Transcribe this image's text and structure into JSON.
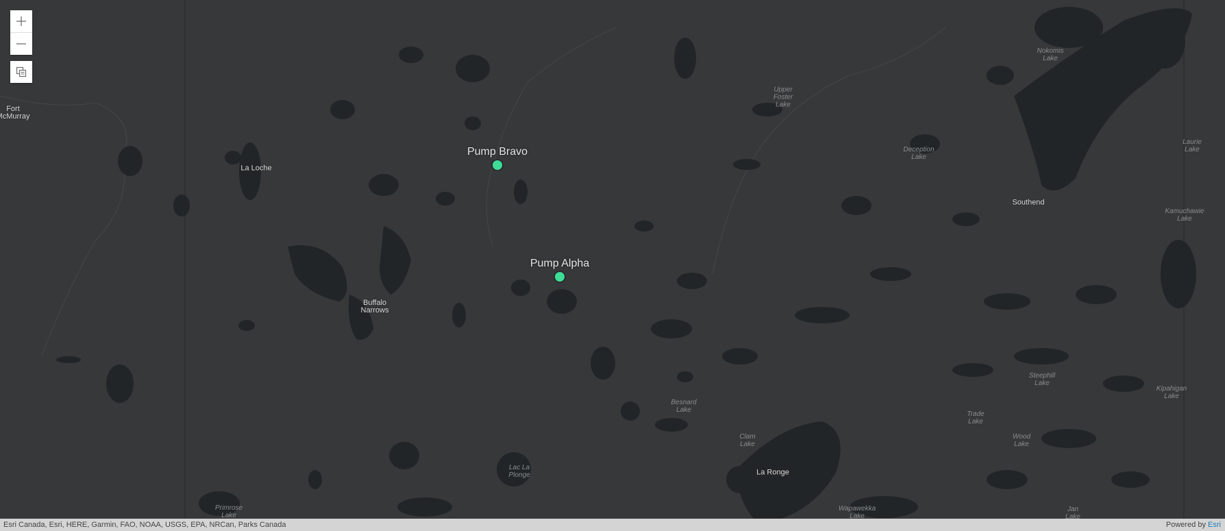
{
  "controls": {
    "zoom_in_icon": "plus-icon",
    "zoom_out_icon": "minus-icon",
    "layers_icon": "layers-icon"
  },
  "places": [
    {
      "id": "fort-mcmurray",
      "label": "Fort\nMcMurray"
    },
    {
      "id": "la-loche",
      "label": "La Loche"
    },
    {
      "id": "buffalo-narrows",
      "label": "Buffalo\nNarrows"
    },
    {
      "id": "southend",
      "label": "Southend"
    },
    {
      "id": "la-ronge",
      "label": "La Ronge"
    }
  ],
  "lakes": [
    {
      "id": "nokomis",
      "label": "Nokomis\nLake"
    },
    {
      "id": "upper-foster",
      "label": "Upper\nFoster\nLake"
    },
    {
      "id": "deception",
      "label": "Deception\nLake"
    },
    {
      "id": "laurie",
      "label": "Laurie\nLake"
    },
    {
      "id": "kamuchawie",
      "label": "Kamuchawie\nLake"
    },
    {
      "id": "besnard",
      "label": "Besnard\nLake"
    },
    {
      "id": "clam",
      "label": "Clam\nLake"
    },
    {
      "id": "trade",
      "label": "Trade\nLake"
    },
    {
      "id": "wood",
      "label": "Wood\nLake"
    },
    {
      "id": "steephill",
      "label": "Steephill\nLake"
    },
    {
      "id": "kipahigan",
      "label": "Kipahigan\nLake"
    },
    {
      "id": "lac-la-plonge",
      "label": "Lac La\nPlonge"
    },
    {
      "id": "primrose",
      "label": "Primrose\nLake"
    },
    {
      "id": "wapawekka",
      "label": "Wapawekka\nLake"
    },
    {
      "id": "jan",
      "label": "Jan\nLake"
    }
  ],
  "pumps": [
    {
      "id": "pump-bravo",
      "label": "Pump Bravo"
    },
    {
      "id": "pump-alpha",
      "label": "Pump Alpha"
    }
  ],
  "attribution": {
    "sources": "Esri Canada, Esri, HERE, Garmin, FAO, NOAA, USGS, EPA, NRCan, Parks Canada",
    "powered_by": "Powered by ",
    "powered_by_link": "Esri"
  },
  "colors": {
    "background": "#363839",
    "water": "#222527",
    "pump_marker": "#3ddc97",
    "boundary": "#2e3031"
  }
}
